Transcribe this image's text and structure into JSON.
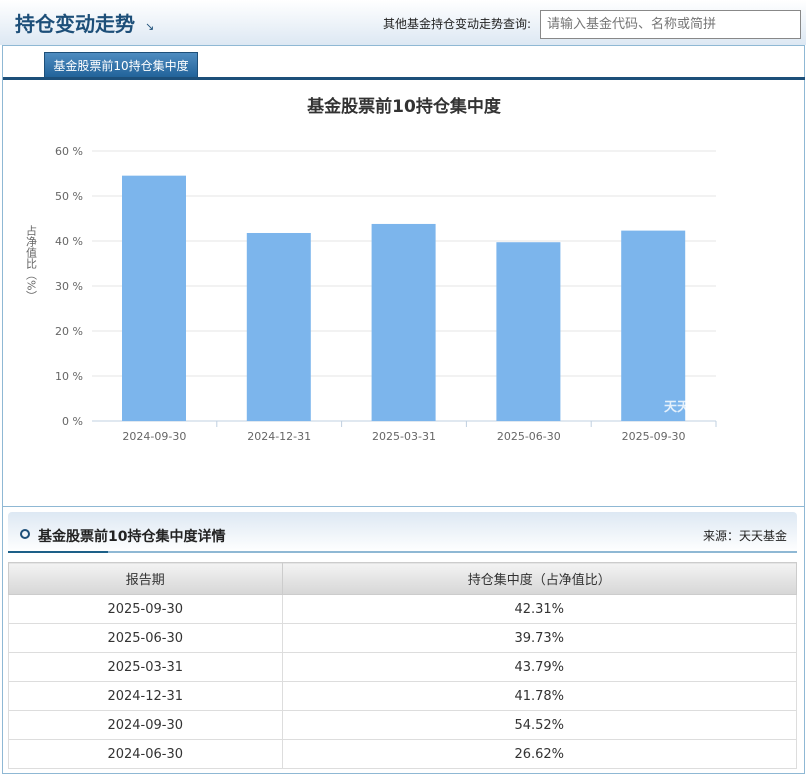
{
  "header": {
    "title": "持仓变动走势",
    "query_label": "其他基金持仓变动走势查询:",
    "search_placeholder": "请输入基金代码、名称或简拼"
  },
  "tabs": [
    {
      "label": "基金股票前10持仓集中度",
      "active": true
    }
  ],
  "chart_data": {
    "type": "bar",
    "title": "基金股票前10持仓集中度",
    "ylabel": "占净值比（%）",
    "categories": [
      "2024-09-30",
      "2024-12-31",
      "2025-03-31",
      "2025-06-30",
      "2025-09-30"
    ],
    "values": [
      54.52,
      41.78,
      43.79,
      39.73,
      42.31
    ],
    "ylim": [
      0,
      60
    ],
    "yticks": [
      "0 %",
      "10 %",
      "20 %",
      "30 %",
      "40 %",
      "50 %",
      "60 %"
    ],
    "grid": true,
    "bar_color": "#7cb5ec",
    "watermark": "天天基金"
  },
  "details": {
    "title": "基金股票前10持仓集中度详情",
    "source": "来源：天天基金",
    "columns": [
      "报告期",
      "持仓集中度（占净值比）"
    ],
    "rows": [
      [
        "2025-09-30",
        "42.31%"
      ],
      [
        "2025-06-30",
        "39.73%"
      ],
      [
        "2025-03-31",
        "43.79%"
      ],
      [
        "2024-12-31",
        "41.78%"
      ],
      [
        "2024-09-30",
        "54.52%"
      ],
      [
        "2024-06-30",
        "26.62%"
      ]
    ]
  }
}
